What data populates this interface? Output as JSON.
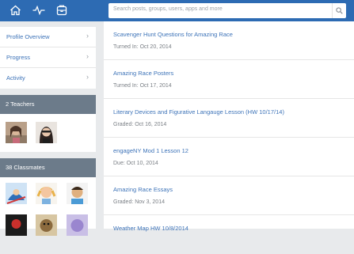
{
  "topbar": {
    "icons": [
      "home-icon",
      "activity-icon",
      "backpack-icon"
    ],
    "search_placeholder": "Search posts, groups, users, apps and more",
    "accent": "#2d6bb3"
  },
  "sidebar": {
    "menu": [
      {
        "label": "Profile Overview"
      },
      {
        "label": "Progress"
      },
      {
        "label": "Activity"
      }
    ],
    "teachers_title": "2 Teachers",
    "classmates_title": "38 Classmates"
  },
  "feed": [
    {
      "title": "Scavenger Hunt Questions for Amazing Race",
      "meta": "Turned In: Oct 20, 2014"
    },
    {
      "title": "Amazing Race Posters",
      "meta": "Turned In: Oct 17, 2014"
    },
    {
      "title": "Literary Devices and Figurative Langauge Lesson (HW 10/17/14)",
      "meta": "Graded: Oct 16, 2014"
    },
    {
      "title": "engageNY Mod 1 Lesson 12",
      "meta": "Due: Oct 10, 2014"
    },
    {
      "title": "Amazing Race Essays",
      "meta": "Graded: Nov 3, 2014"
    },
    {
      "title": "Weather Map HW 10/8/2014",
      "meta": ""
    }
  ]
}
